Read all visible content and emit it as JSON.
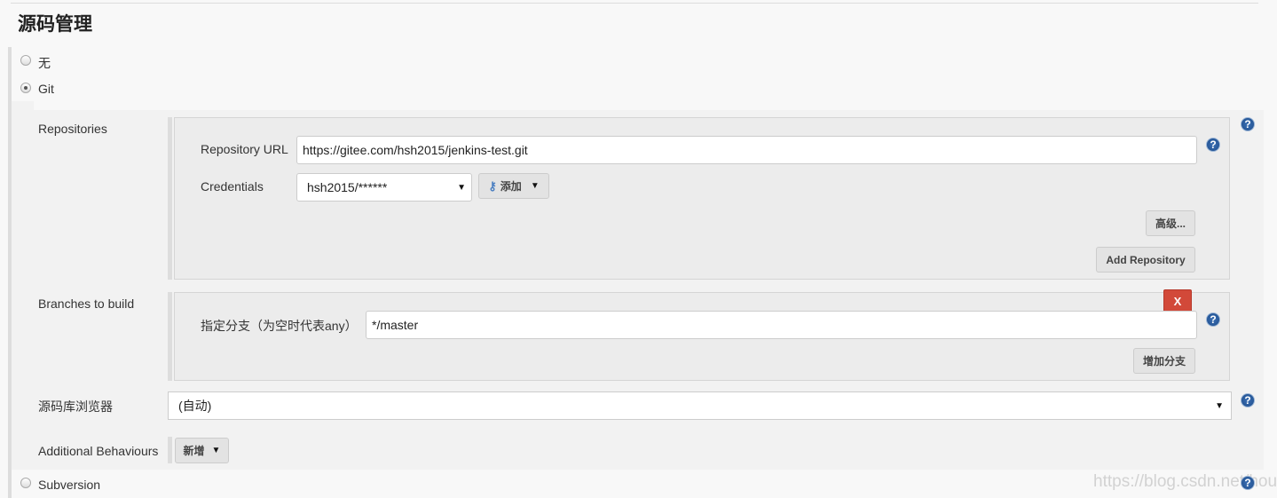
{
  "section_title": "源码管理",
  "scm_options": [
    {
      "label": "无",
      "selected": false
    },
    {
      "label": "Git",
      "selected": true
    },
    {
      "label": "Subversion",
      "selected": false
    }
  ],
  "git": {
    "repositories_label": "Repositories",
    "repo_url_label": "Repository URL",
    "repo_url_value": "https://gitee.com/hsh2015/jenkins-test.git",
    "credentials_label": "Credentials",
    "credentials_value": "hsh2015/******",
    "add_button": "添加",
    "advanced_button": "高级...",
    "add_repository_button": "Add Repository",
    "branches_label": "Branches to build",
    "branch_specifier_label": "指定分支（为空时代表any）",
    "branch_specifier_value": "*/master",
    "delete_button": "X",
    "add_branch_button": "增加分支",
    "browser_label": "源码库浏览器",
    "browser_value": "(自动)",
    "behaviours_label": "Additional Behaviours",
    "behaviours_button": "新增"
  },
  "help_icon": "?",
  "watermark": "https://blog.csdn.net/houge",
  "colors": {
    "delete": "#d24939",
    "help": "#1e4d8c"
  }
}
